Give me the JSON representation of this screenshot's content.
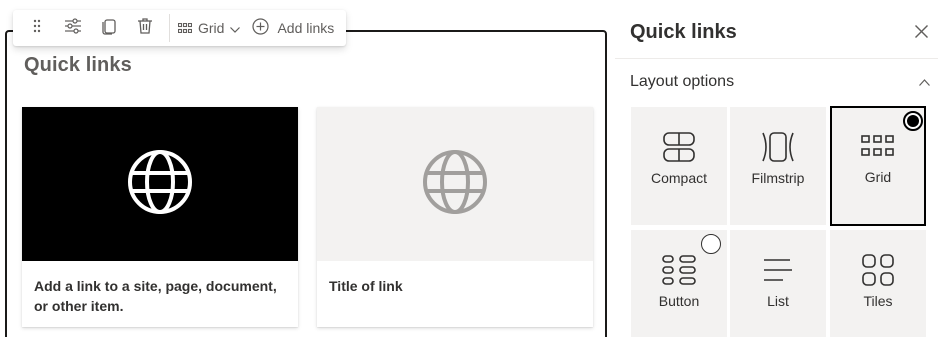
{
  "toolbar": {
    "drag_icon": "gripper-dots-icon",
    "edit_icon": "sliders-icon",
    "duplicate_icon": "copy-icon",
    "delete_icon": "trash-icon",
    "layout_label": "Grid",
    "add_label": "Add links"
  },
  "webpart": {
    "title": "Quick links",
    "cards": [
      {
        "title": "Add a link to a site, page, document, or other item.",
        "icon": "globe-icon",
        "thumb_color": "#000000",
        "icon_color": "#ffffff"
      },
      {
        "title": "Title of link",
        "icon": "globe-icon",
        "thumb_color": "#f3f2f1",
        "icon_color": "#a19f9d"
      }
    ]
  },
  "pane": {
    "title": "Quick links",
    "close_icon": "close-icon",
    "section_label": "Layout options",
    "section_expanded": true,
    "layouts": [
      {
        "label": "Compact",
        "icon": "compact-layout-icon",
        "selected": false
      },
      {
        "label": "Filmstrip",
        "icon": "filmstrip-layout-icon",
        "selected": false
      },
      {
        "label": "Grid",
        "icon": "grid-layout-icon",
        "selected": true
      },
      {
        "label": "Button",
        "icon": "button-layout-icon",
        "selected": false
      },
      {
        "label": "List",
        "icon": "list-layout-icon",
        "selected": false
      },
      {
        "label": "Tiles",
        "icon": "tiles-layout-icon",
        "selected": false
      }
    ]
  },
  "colors": {
    "accent_border": "#000000",
    "tile_bg": "#f3f2f1",
    "text": "#323130",
    "muted": "#605e5c"
  }
}
